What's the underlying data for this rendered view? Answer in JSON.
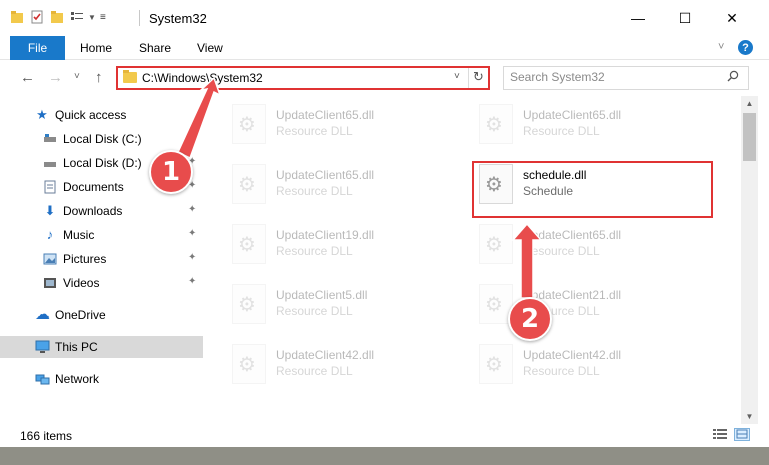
{
  "window": {
    "title": "System32",
    "controls": {
      "minimize": "—",
      "maximize": "☐",
      "close": "✕"
    }
  },
  "ribbon": {
    "file_tab": "File",
    "tabs": [
      "Home",
      "Share",
      "View"
    ],
    "expand_chevron": "˅",
    "help": "?"
  },
  "nav": {
    "back": "←",
    "forward": "→",
    "recent": "˅",
    "up": "↑",
    "address_path": "C:\\Windows\\System32",
    "address_dropdown": "˅",
    "refresh": "↻",
    "search_placeholder": "Search System32",
    "search_icon": "⚲"
  },
  "sidebar": {
    "items": [
      {
        "label": "Quick access",
        "icon": "star-icon",
        "glyph": "★",
        "color": "#1f6fc5",
        "pinned": false
      },
      {
        "label": "Local Disk (C:)",
        "icon": "drive-c-icon",
        "glyph": "▬",
        "color": "#5a5a5a",
        "pinned": true
      },
      {
        "label": "Local Disk (D:)",
        "icon": "drive-d-icon",
        "glyph": "▬",
        "color": "#5a5a5a",
        "pinned": true
      },
      {
        "label": "Documents",
        "icon": "documents-icon",
        "glyph": "▤",
        "color": "#6a7e99",
        "pinned": true
      },
      {
        "label": "Downloads",
        "icon": "downloads-icon",
        "glyph": "⬇",
        "color": "#1f6fc5",
        "pinned": true
      },
      {
        "label": "Music",
        "icon": "music-icon",
        "glyph": "♪",
        "color": "#1f6fc5",
        "pinned": true
      },
      {
        "label": "Pictures",
        "icon": "pictures-icon",
        "glyph": "▣",
        "color": "#4a7fb5",
        "pinned": true
      },
      {
        "label": "Videos",
        "icon": "videos-icon",
        "glyph": "▦",
        "color": "#555555",
        "pinned": true
      },
      {
        "label": "OneDrive",
        "icon": "onedrive-icon",
        "glyph": "☁",
        "color": "#1f6fc5",
        "pinned": false
      },
      {
        "label": "This PC",
        "icon": "this-pc-icon",
        "glyph": "▭",
        "color": "#2f7dc4",
        "pinned": false
      },
      {
        "label": "Network",
        "icon": "network-icon",
        "glyph": "⧉",
        "color": "#2f7dc4",
        "pinned": false
      }
    ],
    "selected": "This PC",
    "pin_glyph": "📌"
  },
  "files": [
    {
      "name": "UpdateClient65.dll",
      "type": "Resource DLL",
      "faded": true
    },
    {
      "name": "UpdateClient65.dll",
      "type": "Resource DLL",
      "faded": true
    },
    {
      "name": "UpdateClient65.dll",
      "type": "Resource DLL",
      "faded": true
    },
    {
      "name": "schedule.dll",
      "type": "Schedule",
      "faded": false
    },
    {
      "name": "UpdateClient19.dll",
      "type": "Resource DLL",
      "faded": true
    },
    {
      "name": "UpdateClient65.dll",
      "type": "Resource DLL",
      "faded": true
    },
    {
      "name": "UpdateClient5.dll",
      "type": "Resource DLL",
      "faded": true
    },
    {
      "name": "UpdateClient21.dll",
      "type": "Resource DLL",
      "faded": true
    },
    {
      "name": "UpdateClient42.dll",
      "type": "Resource DLL",
      "faded": true
    },
    {
      "name": "UpdateClient42.dll",
      "type": "Resource DLL",
      "faded": true
    }
  ],
  "status": {
    "item_count": "166 items"
  },
  "annotations": {
    "step1": "1",
    "step2": "2",
    "color": "#e84c4c"
  },
  "colors": {
    "accent": "#1979ca",
    "highlight_border": "#e03333",
    "selected_bg": "#d9d9d9"
  }
}
